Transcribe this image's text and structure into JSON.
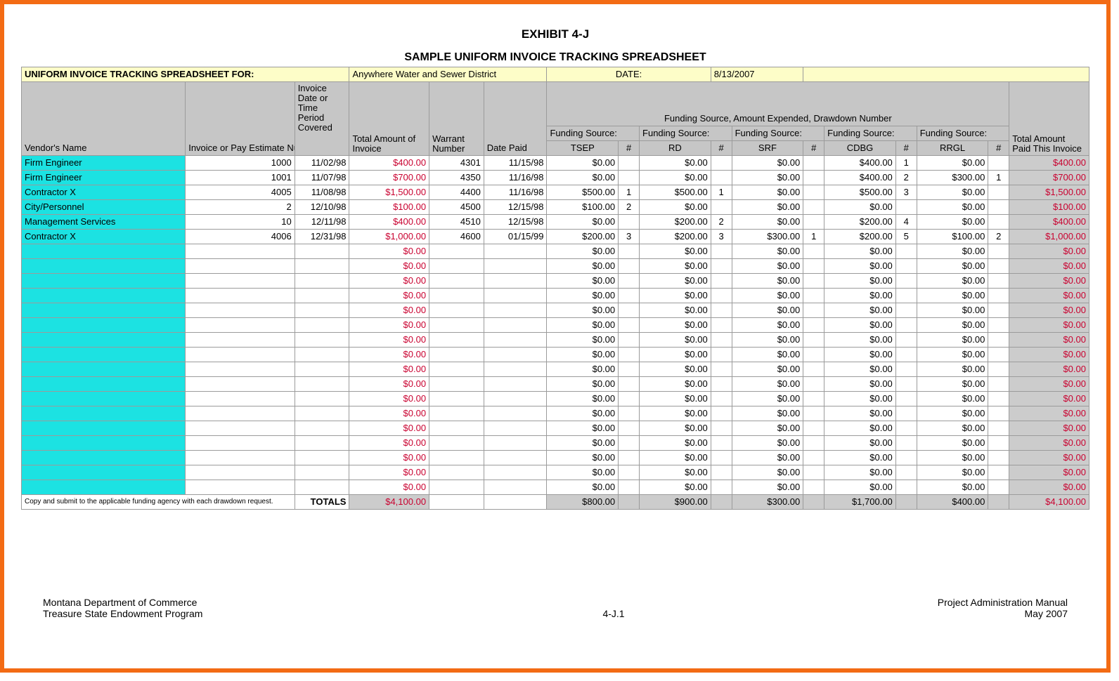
{
  "titles": {
    "exhibit": "EXHIBIT 4-J",
    "subtitle": "SAMPLE UNIFORM INVOICE TRACKING SPREADSHEET"
  },
  "topbar": {
    "label": "UNIFORM INVOICE TRACKING SPREADSHEET FOR:",
    "district": "Anywhere Water and Sewer District",
    "date_label": "DATE:",
    "date_value": "8/13/2007"
  },
  "headers": {
    "vendor": "Vendor's Name",
    "inv_est": "Invoice or Pay Estimate Number",
    "inv_date": "Invoice Date or Time Period Covered",
    "total_inv": "Total Amount of Invoice",
    "warrant": "Warrant Number",
    "date_paid": "Date Paid",
    "fund_super": "Funding Source, Amount Expended, Drawdown Number",
    "fs_label": "Funding Source:",
    "tsep": "TSEP",
    "rd": "RD",
    "srf": "SRF",
    "cdbg": "CDBG",
    "rrgl": "RRGL",
    "num": "#",
    "total_paid": "Total Amount Paid This Invoice"
  },
  "rows": [
    {
      "vendor": "Firm Engineer",
      "inv": "1000",
      "date": "11/02/98",
      "total": "$400.00",
      "war": "4301",
      "paid": "11/15/98",
      "tsep": "$0.00",
      "tn": "",
      "rd": "$0.00",
      "rn": "",
      "srf": "$0.00",
      "sn": "",
      "cdbg": "$400.00",
      "cn": "1",
      "rrgl": "$0.00",
      "ln": "",
      "tp": "$400.00"
    },
    {
      "vendor": "Firm Engineer",
      "inv": "1001",
      "date": "11/07/98",
      "total": "$700.00",
      "war": "4350",
      "paid": "11/16/98",
      "tsep": "$0.00",
      "tn": "",
      "rd": "$0.00",
      "rn": "",
      "srf": "$0.00",
      "sn": "",
      "cdbg": "$400.00",
      "cn": "2",
      "rrgl": "$300.00",
      "ln": "1",
      "tp": "$700.00"
    },
    {
      "vendor": "Contractor X",
      "inv": "4005",
      "date": "11/08/98",
      "total": "$1,500.00",
      "war": "4400",
      "paid": "11/16/98",
      "tsep": "$500.00",
      "tn": "1",
      "rd": "$500.00",
      "rn": "1",
      "srf": "$0.00",
      "sn": "",
      "cdbg": "$500.00",
      "cn": "3",
      "rrgl": "$0.00",
      "ln": "",
      "tp": "$1,500.00"
    },
    {
      "vendor": "City/Personnel",
      "inv": "2",
      "date": "12/10/98",
      "total": "$100.00",
      "war": "4500",
      "paid": "12/15/98",
      "tsep": "$100.00",
      "tn": "2",
      "rd": "$0.00",
      "rn": "",
      "srf": "$0.00",
      "sn": "",
      "cdbg": "$0.00",
      "cn": "",
      "rrgl": "$0.00",
      "ln": "",
      "tp": "$100.00"
    },
    {
      "vendor": "Management Services",
      "inv": "10",
      "date": "12/11/98",
      "total": "$400.00",
      "war": "4510",
      "paid": "12/15/98",
      "tsep": "$0.00",
      "tn": "",
      "rd": "$200.00",
      "rn": "2",
      "srf": "$0.00",
      "sn": "",
      "cdbg": "$200.00",
      "cn": "4",
      "rrgl": "$0.00",
      "ln": "",
      "tp": "$400.00"
    },
    {
      "vendor": "Contractor X",
      "inv": "4006",
      "date": "12/31/98",
      "total": "$1,000.00",
      "war": "4600",
      "paid": "01/15/99",
      "tsep": "$200.00",
      "tn": "3",
      "rd": "$200.00",
      "rn": "3",
      "srf": "$300.00",
      "sn": "1",
      "cdbg": "$200.00",
      "cn": "5",
      "rrgl": "$100.00",
      "ln": "2",
      "tp": "$1,000.00"
    }
  ],
  "empty_count": 17,
  "empty": {
    "total": "$0.00",
    "tsep": "$0.00",
    "rd": "$0.00",
    "srf": "$0.00",
    "cdbg": "$0.00",
    "rrgl": "$0.00",
    "tp": "$0.00"
  },
  "totals_row": {
    "note": "Copy and submit to the applicable funding agency with each drawdown request.",
    "label": "TOTALS",
    "total": "$4,100.00",
    "tsep": "$800.00",
    "rd": "$900.00",
    "srf": "$300.00",
    "cdbg": "$1,700.00",
    "rrgl": "$400.00",
    "tp": "$4,100.00"
  },
  "footer": {
    "left1": "Montana Department of Commerce",
    "left2": "Treasure State Endowment Program",
    "center": "4-J.1",
    "right1": "Project Administration Manual",
    "right2": "May 2007"
  },
  "colors": {
    "orange": "#f36b14",
    "yellow": "#fdfdc8",
    "cyan": "#1ce2e2",
    "grey": "#c6c6c6",
    "red": "#c9002f"
  }
}
